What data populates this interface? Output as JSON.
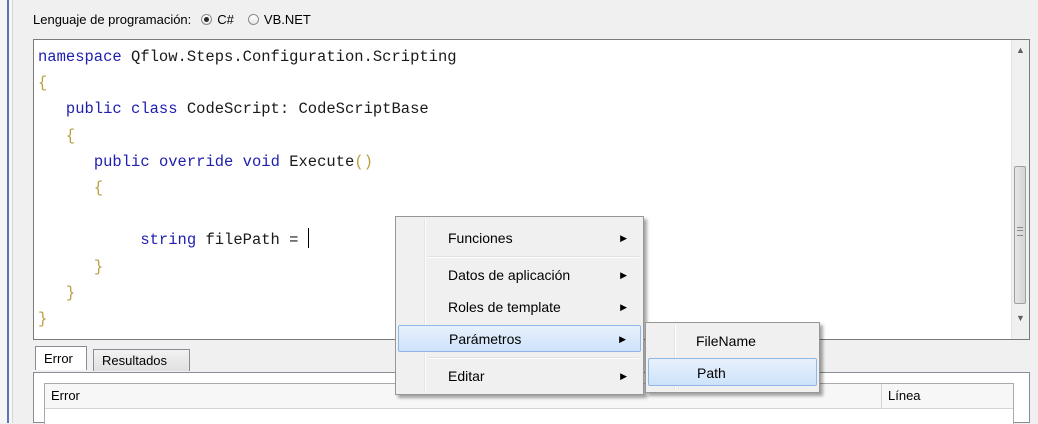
{
  "language_bar": {
    "label": "Lenguaje de programación:",
    "options": [
      {
        "label": "C#",
        "checked": true
      },
      {
        "label": "VB.NET",
        "checked": false
      }
    ]
  },
  "editor": {
    "lines": {
      "l1_kw": "namespace",
      "l1_name": " Qflow.Steps.Configuration.Scripting",
      "l2": "{",
      "l3_kw1": "public",
      "l3_kw2": "class",
      "l3_name": " CodeScript: CodeScriptBase",
      "l4": "{",
      "l5_kw1": "public",
      "l5_kw2": "override",
      "l5_kw3": "void",
      "l5_name": " Execute",
      "l5_parens": "()",
      "l6": "{",
      "l8_kw": "string",
      "l8_name": " filePath = ",
      "l9": "}",
      "l10": "}",
      "l11": "}"
    },
    "colors": {
      "keyword": "#2020b0",
      "brace": "#b8a040"
    }
  },
  "bottom_panel": {
    "tabs": [
      "Error",
      "Resultados"
    ],
    "active_tab": "Error",
    "columns": [
      "Error",
      "Línea"
    ]
  },
  "context_menu": {
    "items": [
      {
        "label": "Funciones",
        "arrow": "▶"
      },
      {
        "label": "Datos de aplicación",
        "arrow": "▶"
      },
      {
        "label": "Roles de template",
        "arrow": "▶"
      },
      {
        "label": "Parámetros",
        "arrow": "▶",
        "highlighted": true
      },
      {
        "label": "Editar",
        "arrow": "▶"
      }
    ],
    "submenu": [
      {
        "label": "FileName"
      },
      {
        "label": "Path",
        "highlighted": true
      }
    ],
    "highlight_color": "#cde2fa"
  }
}
